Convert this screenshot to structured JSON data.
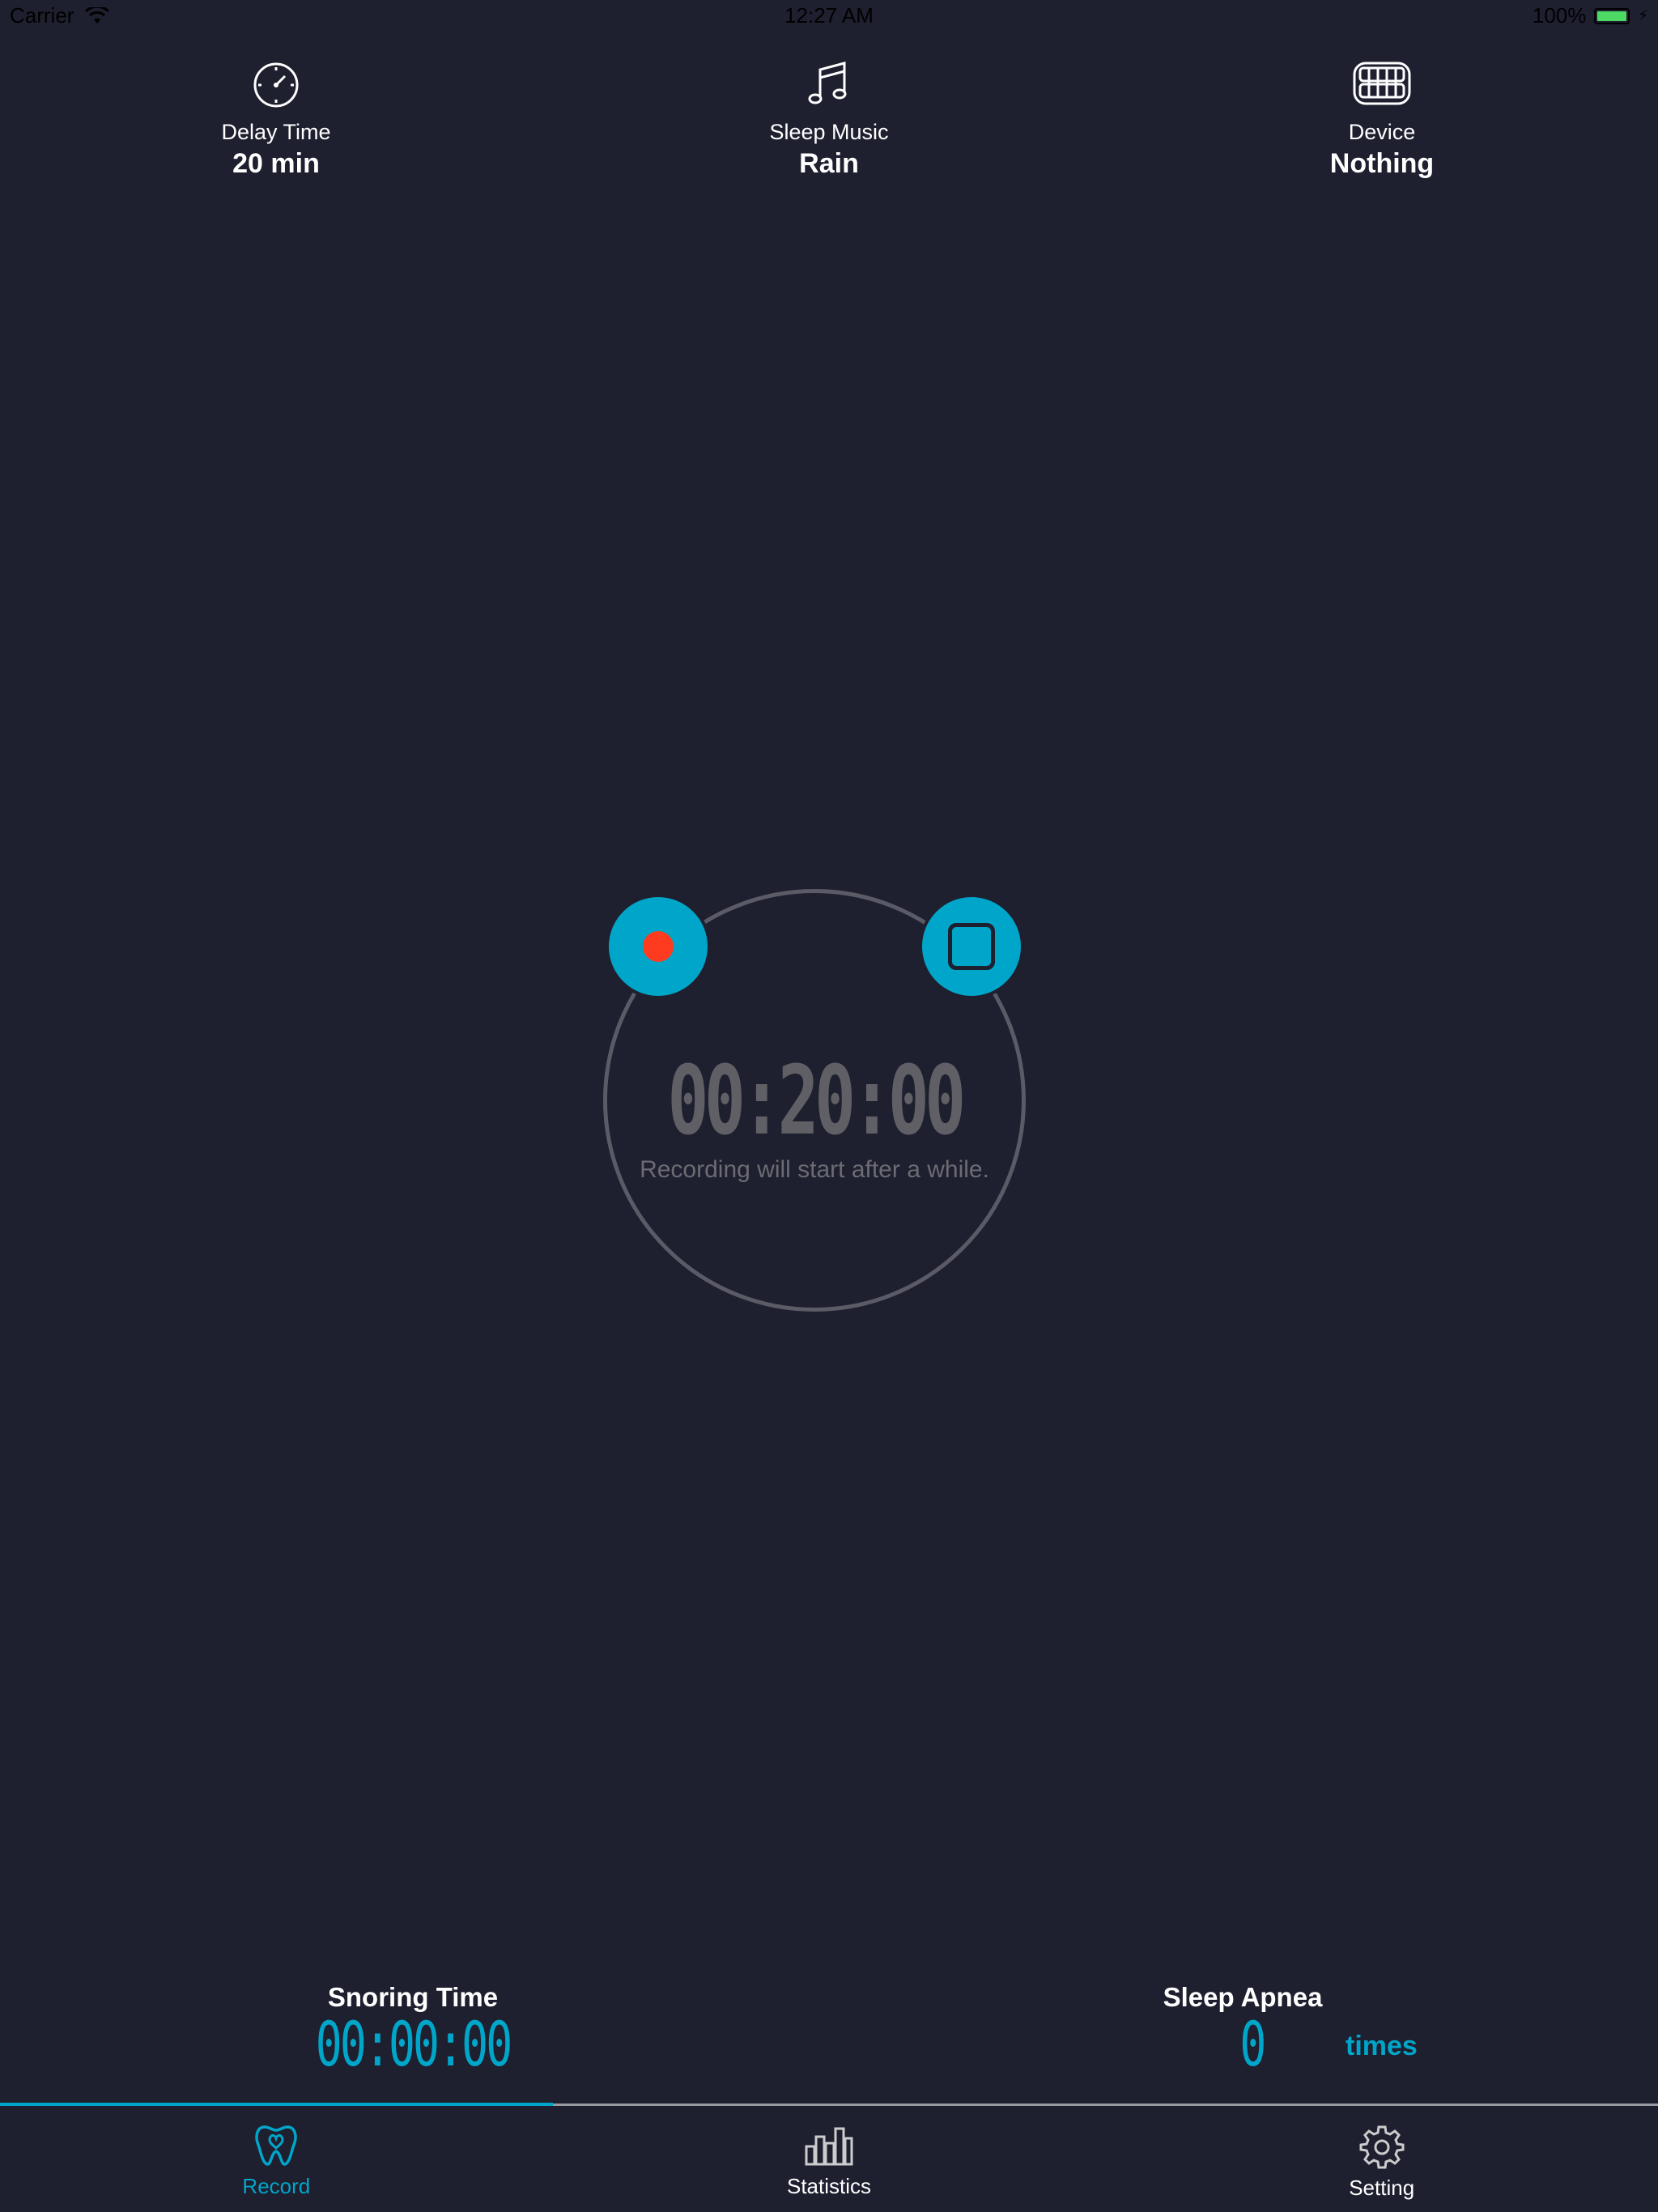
{
  "status_bar": {
    "carrier": "Carrier",
    "time": "12:27 AM",
    "battery": "100%"
  },
  "top_options": {
    "delay": {
      "label": "Delay Time",
      "value": "20 min",
      "icon": "stopwatch-icon"
    },
    "music": {
      "label": "Sleep Music",
      "value": "Rain",
      "icon": "music-note-icon"
    },
    "device": {
      "label": "Device",
      "value": "Nothing",
      "icon": "mouthguard-icon"
    }
  },
  "timer": {
    "countdown": "00:20:00",
    "hint": "Recording will start after a while."
  },
  "stats": {
    "snoring_label": "Snoring Time",
    "snoring_value": "00:00:00",
    "apnea_label": "Sleep Apnea",
    "apnea_value": "0",
    "apnea_unit": "times"
  },
  "tabs": [
    {
      "label": "Record",
      "icon": "tooth-icon",
      "active": true
    },
    {
      "label": "Statistics",
      "icon": "bar-chart-icon",
      "active": false
    },
    {
      "label": "Setting",
      "icon": "gear-icon",
      "active": false
    }
  ],
  "colors": {
    "background": "#1e1f2f",
    "accent": "#00a6c9",
    "record_dot": "#ff3b1f",
    "battery": "#4cd964"
  }
}
